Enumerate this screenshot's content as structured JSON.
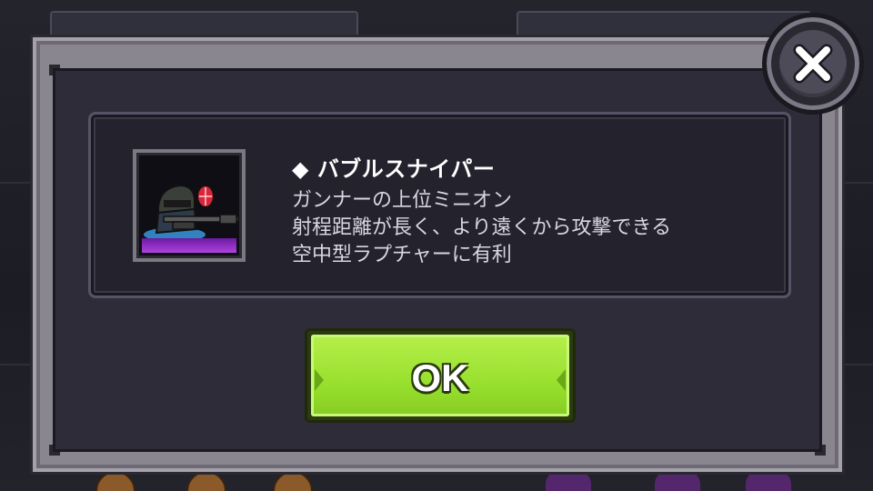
{
  "dialog": {
    "unit_name": "◆ バブルスナイパー",
    "description_lines": [
      "ガンナーの上位ミニオン",
      "射程距離が長く、より遠くから攻撃できる",
      "空中型ラプチャーに有利"
    ],
    "ok_label": "OK",
    "close_icon": "close-x-icon",
    "unit_icon": "bubble-sniper-unit-icon"
  },
  "colors": {
    "ok_button": "#9fe334",
    "panel": "#2d2c38",
    "frame": "#8a8690",
    "text": "#ffffff"
  }
}
